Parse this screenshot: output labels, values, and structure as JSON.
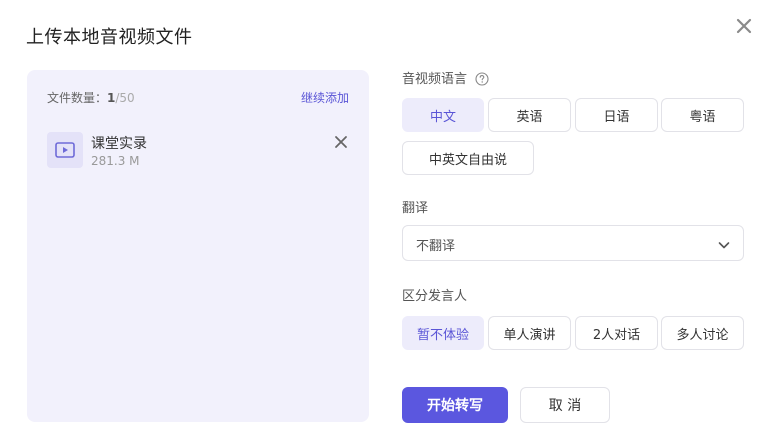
{
  "dialog": {
    "title": "上传本地音视频文件"
  },
  "file_panel": {
    "count_label": "文件数量：",
    "count_current": "1",
    "count_separator": "/",
    "count_max": "50",
    "add_more": "继续添加",
    "files": [
      {
        "name": "课堂实录",
        "size": "281.3 M",
        "icon": "video-play-icon"
      }
    ]
  },
  "language": {
    "label": "音视频语言",
    "options": [
      "中文",
      "英语",
      "日语",
      "粤语",
      "中英文自由说"
    ],
    "selected": "中文"
  },
  "translation": {
    "label": "翻译",
    "value": "不翻译"
  },
  "speaker": {
    "label": "区分发言人",
    "options": [
      "暂不体验",
      "单人演讲",
      "2人对话",
      "多人讨论"
    ],
    "selected": "暂不体验"
  },
  "actions": {
    "start": "开始转写",
    "cancel": "取 消"
  },
  "colors": {
    "accent": "#5b57df",
    "panel_bg": "#f2f1fc",
    "active_option_bg": "#edecfb"
  }
}
